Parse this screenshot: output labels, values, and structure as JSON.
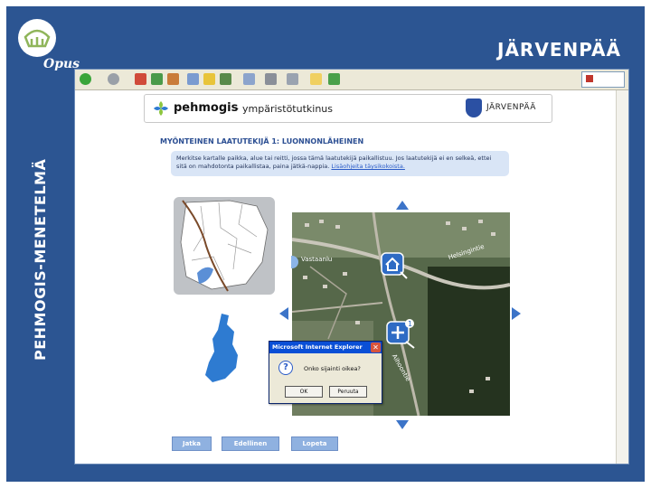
{
  "slide": {
    "side_title": "PEHMOGIS-MENETELMÄ",
    "top_title": "JÄRVENPÄÄ",
    "logo_text": "Opus"
  },
  "site": {
    "brand": "pehmogis",
    "subtitle": "· ympäristötutkinus",
    "city_logo": "JÄRVENPÄÄ",
    "section_title": "MYÖNTEINEN LAATUTEKIJÄ 1: LUONNONLÄHEINEN",
    "instruction": "Merkitse kartalle paikka, alue tai reitti, jossa tämä laatutekijä paikallistuu. Jos laatutekijä ei en selkeä, ettei sitä on mahdotonta paikallistaa, paina jätkä-nappia.",
    "instruction_link": "Lisäohjeita täysikokoista.",
    "map_labels": {
      "left": "Vastaanlu",
      "right": "Helsingintie",
      "road": "Aihoontie"
    }
  },
  "dialog": {
    "title": "Microsoft Internet Explorer",
    "close": "✕",
    "message": "Onko sijainti oikea?",
    "ok": "OK",
    "cancel": "Peruuta"
  },
  "buttons": {
    "next": "Jatka",
    "previous": "Edellinen",
    "finish": "Lopeta"
  },
  "colors": {
    "slide_blue": "#2c5592",
    "accent_blue": "#3c74c8",
    "button_blue": "#8fb1e0",
    "instruction_bg": "#d9e5f6"
  },
  "icons": [
    "back-icon",
    "forward-icon",
    "stop-icon",
    "refresh-icon",
    "home-icon",
    "search-icon",
    "favorites-icon",
    "history-icon",
    "mail-icon",
    "print-icon",
    "edit-icon",
    "messenger-icon",
    "home-marker-icon",
    "zoom-in-icon",
    "question-icon"
  ]
}
